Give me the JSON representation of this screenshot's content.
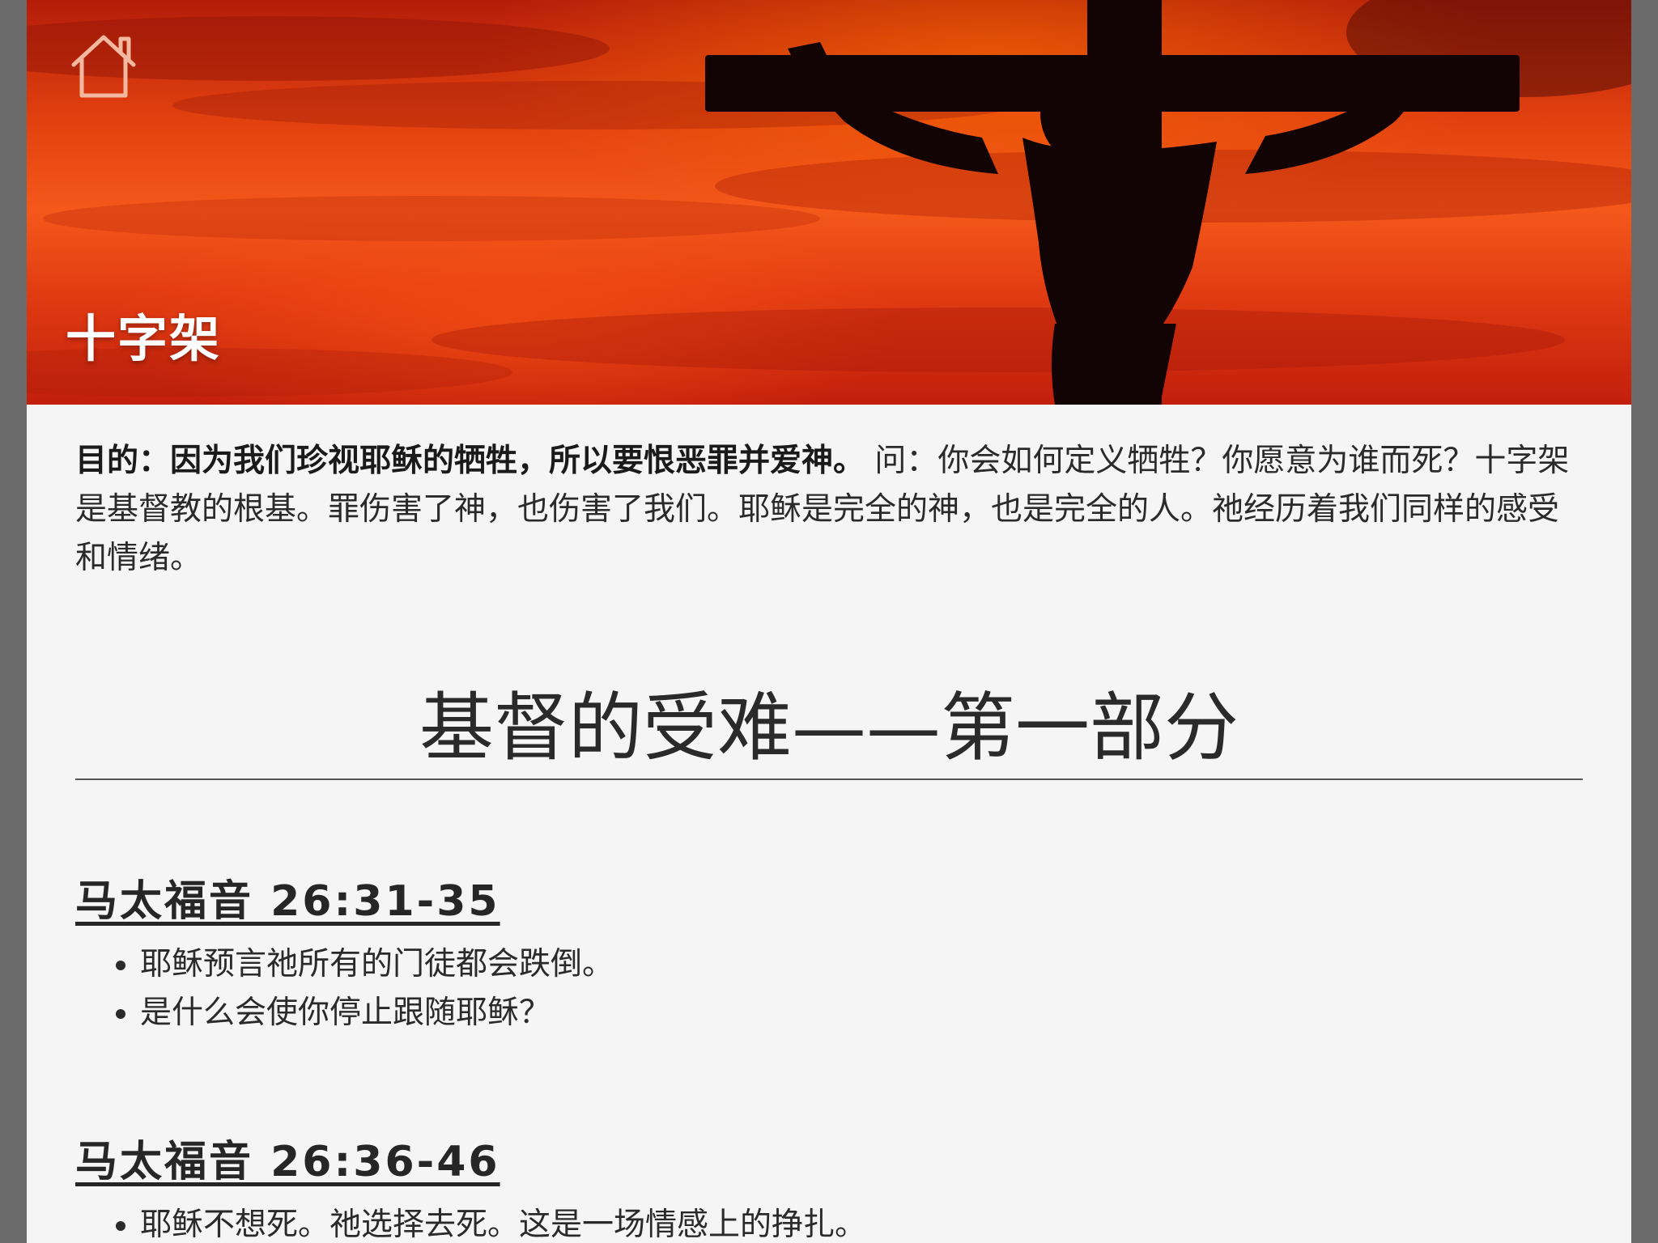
{
  "hero": {
    "title": "十字架",
    "home_icon": "home-icon"
  },
  "intro": {
    "purpose_label": "目的：因为我们珍视耶稣的牺牲，所以要恨恶罪并爱神。",
    "text": " 问：你会如何定义牺牲？你愿意为谁而死？十字架是基督教的根基。罪伤害了神，也伤害了我们。耶稣是完全的神，也是完全的人。祂经历着我们同样的感受和情绪。"
  },
  "section": {
    "title": "基督的受难——第一部分"
  },
  "passages": [
    {
      "reference": "马太福音 26:31-35",
      "points": [
        "耶稣预言祂所有的门徒都会跌倒。",
        "是什么会使你停止跟随耶稣？"
      ]
    },
    {
      "reference": "马太福音 26:36-46",
      "points": [
        "耶稣不想死。祂选择去死。这是一场情感上的挣扎。"
      ]
    }
  ],
  "colors": {
    "page_bg": "#f5f5f5",
    "frame_bg": "#6b6b6b",
    "hero_orange": "#f4581a",
    "hero_red": "#b51d0a",
    "text": "#2a2a2a"
  }
}
